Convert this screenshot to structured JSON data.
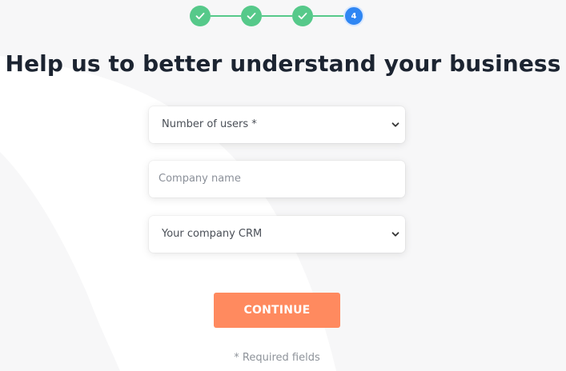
{
  "stepper": {
    "current_step": "4",
    "completed_steps": 3
  },
  "title": "Help us to better understand your business",
  "form": {
    "users_select": {
      "value": "Number of users *"
    },
    "company_name": {
      "placeholder": "Company name"
    },
    "crm_select": {
      "value": "Your company CRM"
    }
  },
  "continue_label": "CONTINUE",
  "required_note": "* Required fields",
  "colors": {
    "step_done": "#56c98a",
    "step_current": "#2f86f3",
    "button": "#ff8a5f",
    "title": "#1c2431"
  }
}
